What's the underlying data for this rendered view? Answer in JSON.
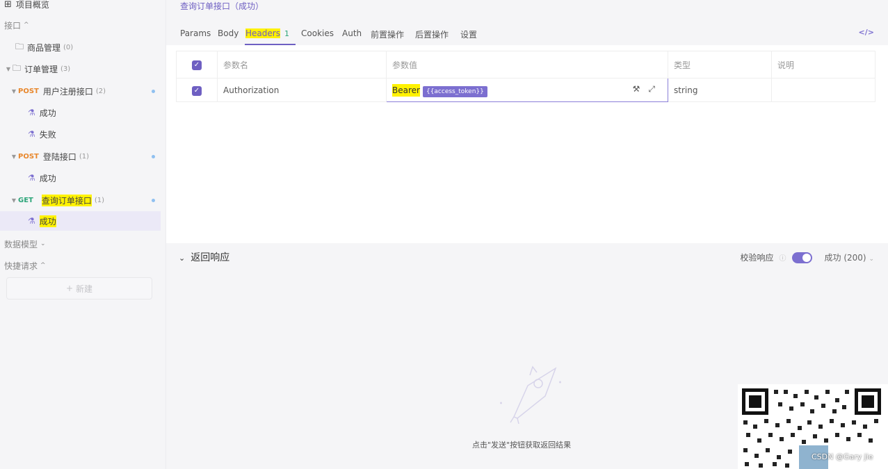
{
  "sidebar": {
    "overview": "项目概览",
    "interfaces_label": "接口",
    "items": [
      {
        "label": "商品管理",
        "count": "(0)"
      },
      {
        "label": "订单管理",
        "count": "(3)"
      },
      {
        "method": "POST",
        "label": "用户注册接口",
        "count": "(2)"
      },
      {
        "label": "成功"
      },
      {
        "label": "失败"
      },
      {
        "method": "POST",
        "label": "登陆接口",
        "count": "(1)"
      },
      {
        "label": "成功"
      },
      {
        "method": "GET",
        "label": "查询订单接口",
        "count": "(1)"
      },
      {
        "label": "成功"
      }
    ],
    "data_model": "数据模型",
    "quick_request": "快捷请求",
    "new_button": "新建"
  },
  "breadcrumb": "查询订单接口（成功）",
  "tabs": [
    {
      "label": "Params"
    },
    {
      "label": "Body"
    },
    {
      "label": "Headers",
      "badge": "1"
    },
    {
      "label": "Cookies"
    },
    {
      "label": "Auth"
    },
    {
      "label": "前置操作"
    },
    {
      "label": "后置操作"
    },
    {
      "label": "设置"
    }
  ],
  "code_icon": "</>",
  "table": {
    "headers": [
      "参数名",
      "参数值",
      "类型",
      "说明"
    ],
    "rows": [
      {
        "name": "Authorization",
        "value_prefix": "Bearer",
        "token": "{{access_token}}",
        "type": "string",
        "desc": ""
      }
    ]
  },
  "response": {
    "title": "返回响应",
    "validate_label": "校验响应",
    "status": "成功 (200)",
    "empty_text": "点击\"发送\"按钮获取返回结果"
  },
  "watermark": "CSDN @Gary jie",
  "colors": {
    "accent": "#6e5fc2",
    "post": "#e8872c",
    "get": "#2ca579",
    "highlight": "#fff200"
  }
}
